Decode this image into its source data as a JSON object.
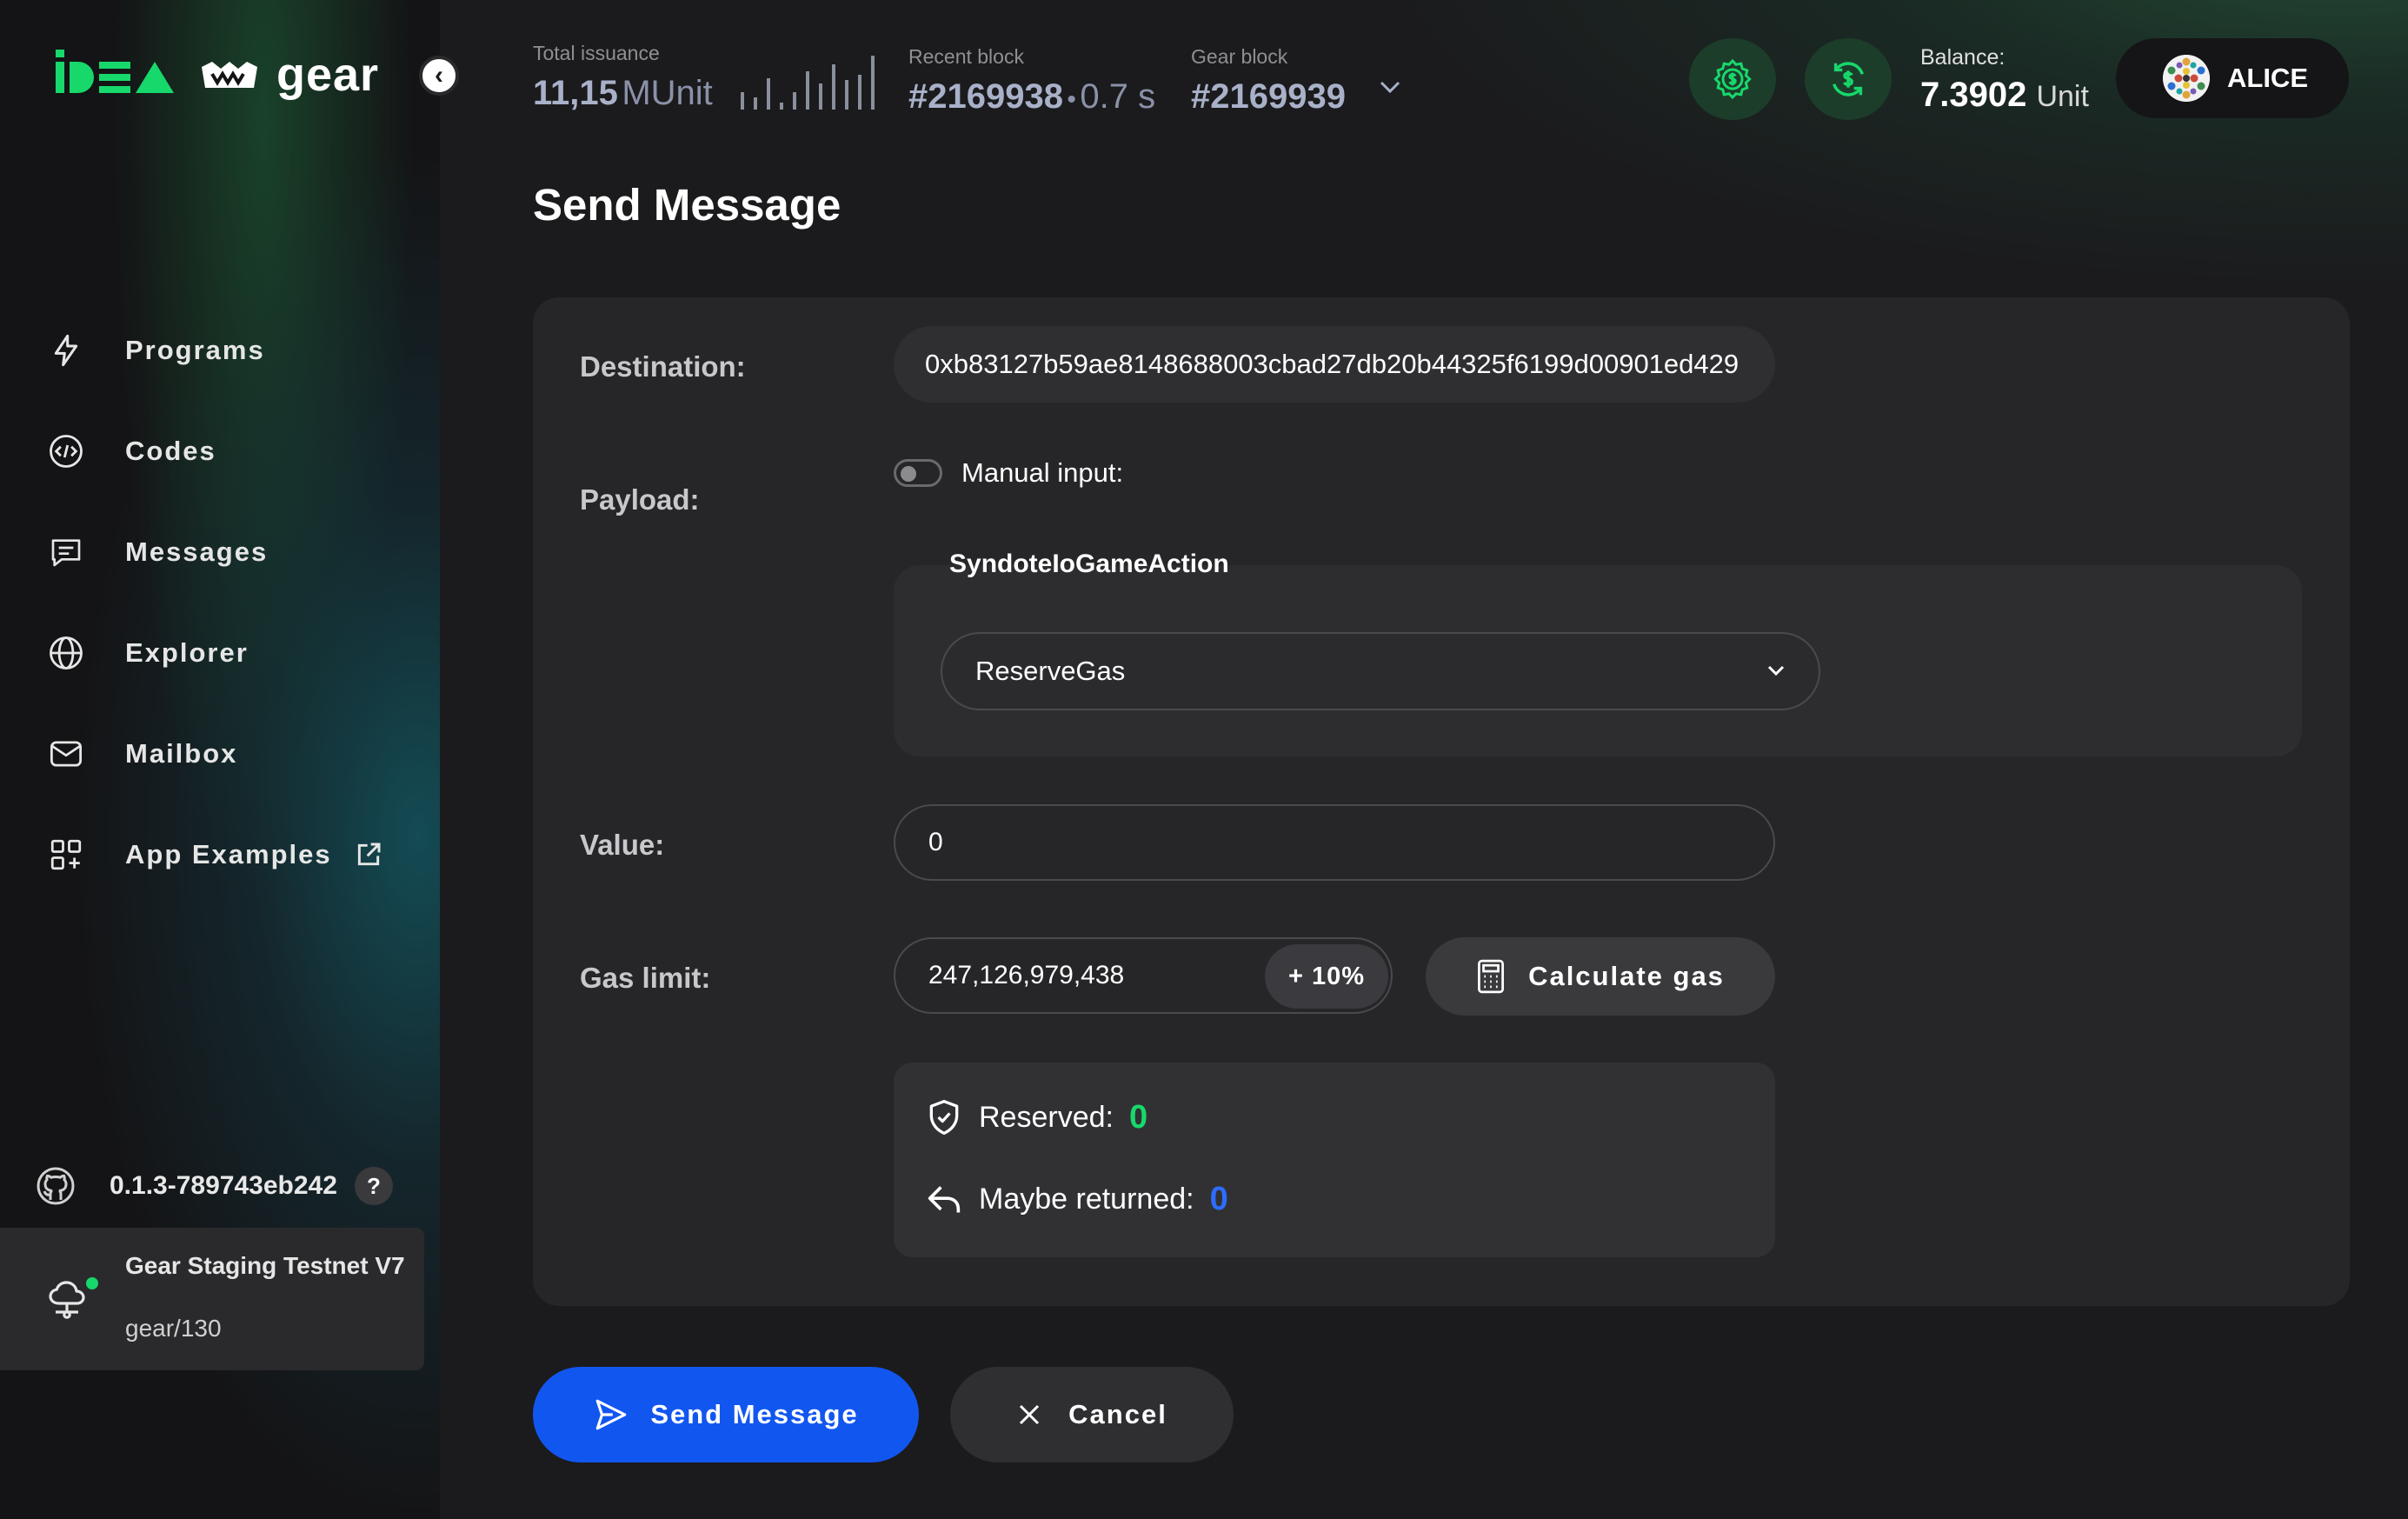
{
  "brand": {
    "idea_logo": "IDEA",
    "gear_text": "gear"
  },
  "colors": {
    "accent_green": "#17d86b",
    "primary_blue": "#1256f0",
    "reserved_green": "#17d86b",
    "returned_blue": "#2d6cff"
  },
  "header": {
    "total_issuance": {
      "label": "Total issuance",
      "value": "11,15",
      "unit": "MUnit"
    },
    "recent_block": {
      "label": "Recent block",
      "value": "#2169938",
      "separator": "•",
      "time": "0.7 s"
    },
    "gear_block": {
      "label": "Gear block",
      "value": "#2169939"
    },
    "balance": {
      "label": "Balance:",
      "value": "7.3902",
      "unit": "Unit"
    },
    "account": {
      "name": "ALICE"
    },
    "icons": [
      "settings-coin-icon",
      "dollar-transfer-icon"
    ]
  },
  "sidebar": {
    "items": [
      {
        "label": "Programs",
        "icon": "lightning-icon"
      },
      {
        "label": "Codes",
        "icon": "code-icon"
      },
      {
        "label": "Messages",
        "icon": "message-icon"
      },
      {
        "label": "Explorer",
        "icon": "globe-icon"
      },
      {
        "label": "Mailbox",
        "icon": "mail-icon"
      },
      {
        "label": "App Examples",
        "icon": "apps-icon"
      }
    ],
    "version": "0.1.3-789743eb242",
    "help": "?",
    "network": {
      "name": "Gear Staging Testnet V7",
      "node": "gear/130"
    }
  },
  "main": {
    "title": "Send Message",
    "destination": {
      "label": "Destination:",
      "value": "0xb83127b59ae8148688003cbad27db20b44325f6199d00901ed429"
    },
    "payload": {
      "label": "Payload:",
      "manual_input_label": "Manual input:",
      "type_name": "SyndoteIoGameAction",
      "selected": "ReserveGas"
    },
    "value": {
      "label": "Value:",
      "value": "0"
    },
    "gas_limit": {
      "label": "Gas limit:",
      "value": "247,126,979,438",
      "increase_label": "+ 10%",
      "calculate_label": "Calculate gas"
    },
    "gas_info": {
      "reserved_label": "Reserved:",
      "reserved_value": "0",
      "returned_label": "Maybe returned:",
      "returned_value": "0"
    },
    "actions": {
      "send_label": "Send Message",
      "cancel_label": "Cancel"
    }
  }
}
